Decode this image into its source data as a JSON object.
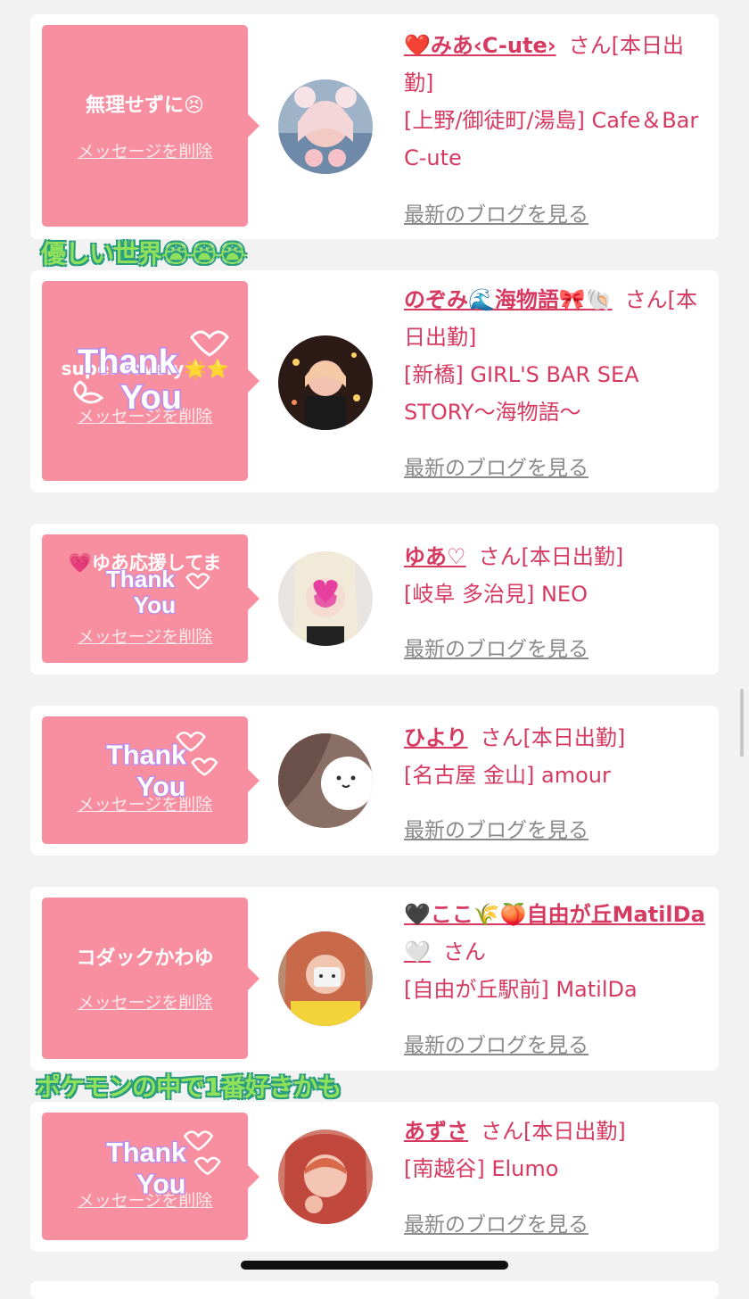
{
  "cards": [
    {
      "message": "無理せずに😣",
      "delete_label": "メッセージを削除",
      "name": "❤️みあ‹C-ute›",
      "san": "さん",
      "status": "[本日出勤]",
      "shop": "[上野/御徒町/湯島] Cafe＆Bar C-ute",
      "blog": "最新のブログを見る"
    },
    {
      "message": "super lovely🌟⭐",
      "delete_label": "メッセージを削除",
      "sticker": "Thank You",
      "name": "のぞみ🌊海物語🎀🐚",
      "san": "さん",
      "status": "[本日出勤]",
      "shop": "[新橋] GIRL'S BAR SEA STORY〜海物語〜",
      "blog": "最新のブログを見る"
    },
    {
      "message": "💗ゆあ応援してま",
      "delete_label": "メッセージを削除",
      "sticker": "Thank You",
      "name": "ゆあ♡",
      "san": "さん",
      "status": "[本日出勤]",
      "shop": "[岐阜 多治見] NEO",
      "blog": "最新のブログを見る"
    },
    {
      "message": "",
      "delete_label": "メッセージを削除",
      "sticker": "Thank You",
      "name": "ひより",
      "san": "さん",
      "status": "[本日出勤]",
      "shop": "[名古屋 金山] amour",
      "blog": "最新のブログを見る"
    },
    {
      "message": "コダックかわゆ",
      "delete_label": "メッセージを削除",
      "name": "🖤ここ🌾🍑自由が丘MatilDa🤍",
      "san": "さん",
      "status": "",
      "shop": "[自由が丘駅前] MatilDa",
      "blog": "最新のブログを見る"
    },
    {
      "message": "",
      "delete_label": "メッセージを削除",
      "sticker": "Thank You",
      "name": "あずさ",
      "san": "さん",
      "status": "[本日出勤]",
      "shop": "[南越谷] Elumo",
      "blog": "最新のブログを見る"
    }
  ],
  "captions": {
    "first": "優しい世界😭😭😭",
    "second": "ポケモンの中で1番好きかも"
  },
  "colors": {
    "background": "#f2f2f2",
    "bubble": "#f78fa0",
    "accent": "#d63a61",
    "link_gray": "#8a8a8a",
    "caption_fill": "#8fe05a",
    "caption_stroke": "#2a9d7f"
  }
}
